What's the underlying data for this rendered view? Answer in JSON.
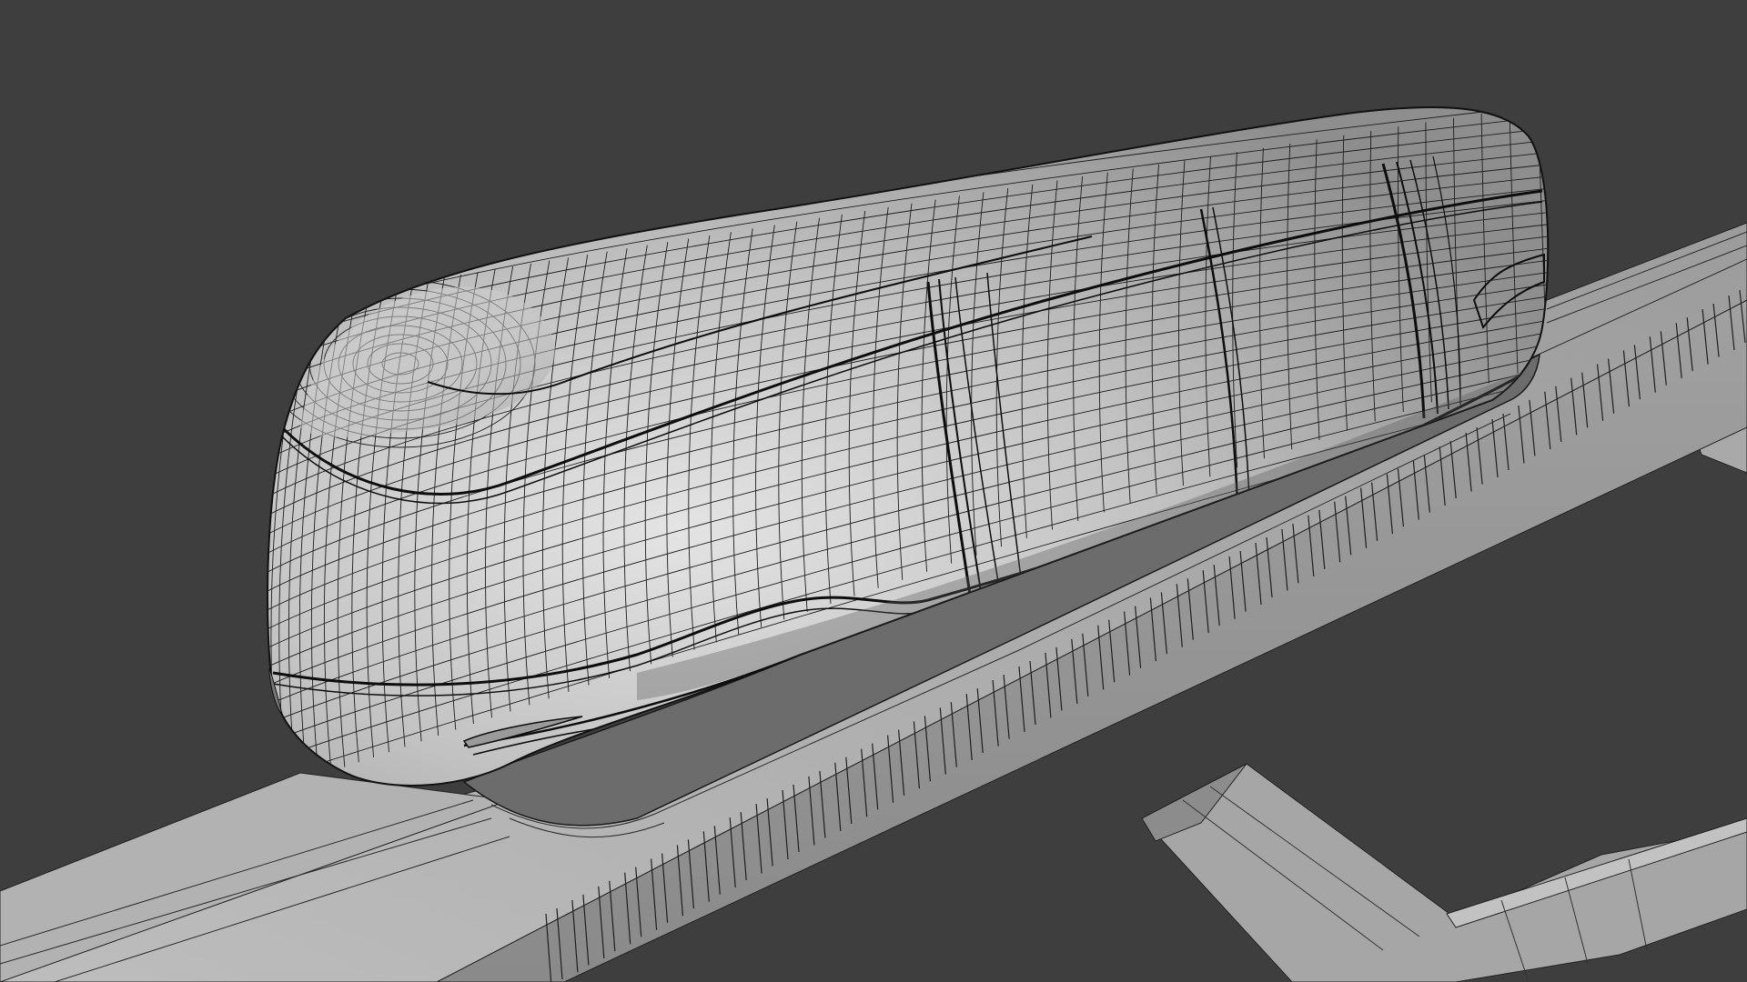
{
  "viewport": {
    "background": "#3e3e3e",
    "render_mode": "wireframe-over-solid",
    "subject": "monorail-train",
    "wire_color": "#1a1a1a",
    "body_color": "#bdbdbd",
    "track_color": "#a9a9a9",
    "underside_color": "#6e6e6e"
  }
}
